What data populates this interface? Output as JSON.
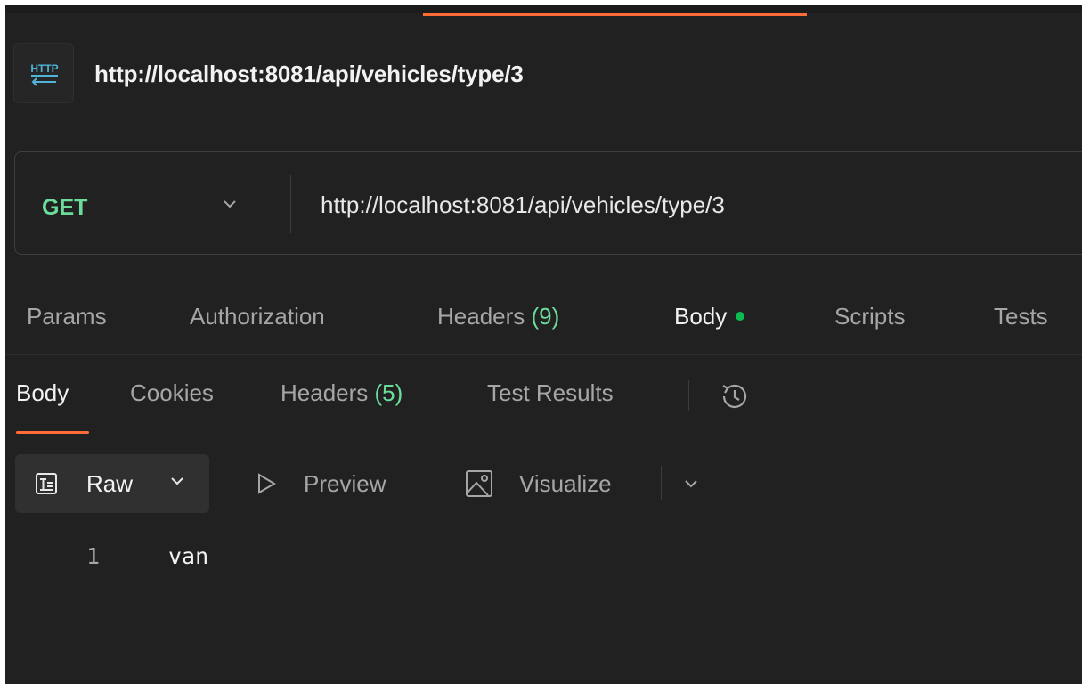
{
  "request": {
    "icon_badge": "HTTP",
    "title": "http://localhost:8081/api/vehicles/type/3",
    "method": "GET",
    "url": "http://localhost:8081/api/vehicles/type/3"
  },
  "request_tabs": [
    {
      "label": "Params"
    },
    {
      "label": "Authorization"
    },
    {
      "label": "Headers",
      "count": "(9)"
    },
    {
      "label": "Body"
    },
    {
      "label": "Scripts"
    },
    {
      "label": "Tests"
    }
  ],
  "response_tabs": [
    {
      "label": "Body"
    },
    {
      "label": "Cookies"
    },
    {
      "label": "Headers",
      "count": "(5)"
    },
    {
      "label": "Test Results"
    }
  ],
  "view_options": {
    "raw": "Raw",
    "preview": "Preview",
    "visualize": "Visualize"
  },
  "response_body": {
    "lines": [
      {
        "number": "1",
        "text": "van"
      }
    ]
  },
  "colors": {
    "accent": "#ff6c37",
    "method_get": "#6bdd9a",
    "active_dot": "#0cbb52",
    "background": "#212121"
  }
}
